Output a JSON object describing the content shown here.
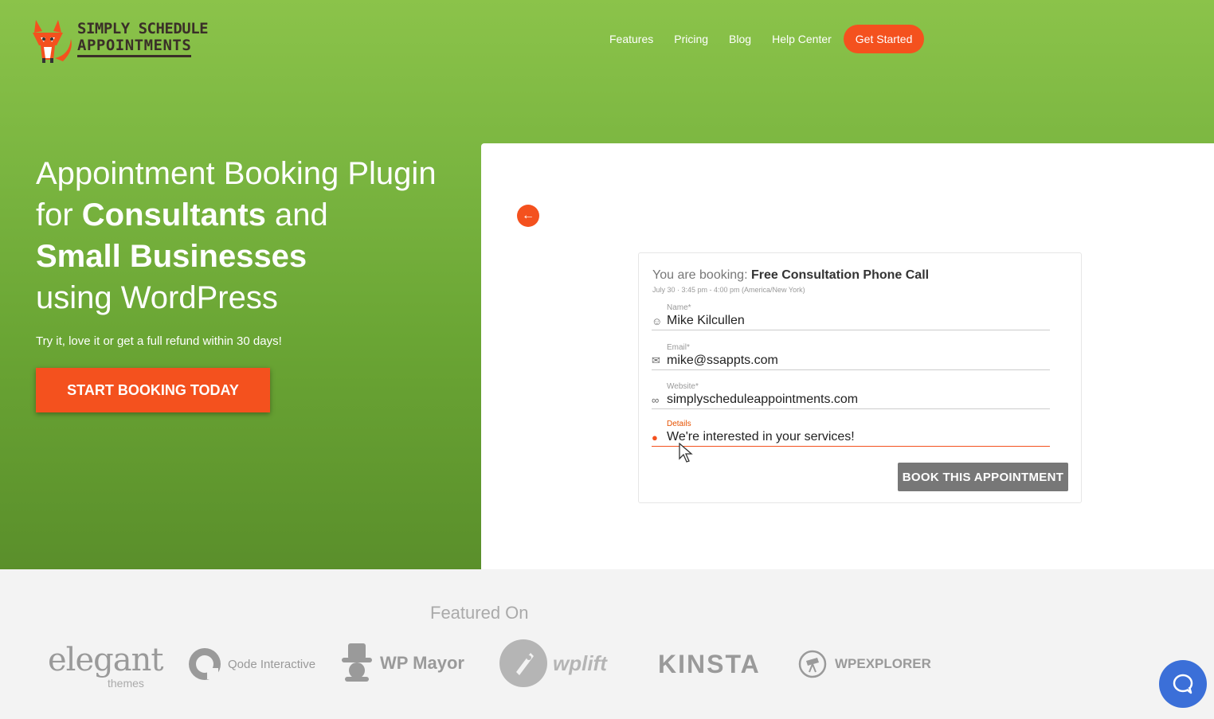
{
  "logo": {
    "line1": "SIMPLY SCHEDULE",
    "line2": "APPOINTMENTS"
  },
  "nav": {
    "items": [
      "Features",
      "Pricing",
      "Blog",
      "Help Center"
    ],
    "cta": "Get Started"
  },
  "hero": {
    "line1": "Appointment Booking Plugin",
    "line2_pre": "for ",
    "line2_bold": "Consultants",
    "line2_post": " and",
    "line3_bold": "Small Businesses",
    "line4": "using WordPress",
    "subtitle": "Try it, love it or get a full refund within 30 days!",
    "button": "START BOOKING TODAY"
  },
  "booking": {
    "title_prefix": "You are booking: ",
    "title_event": "Free Consultation Phone Call",
    "subtitle": "July 30  ·  3:45 pm - 4:00 pm (America/New York)",
    "fields": [
      {
        "label": "Name*",
        "value": "Mike Kilcullen",
        "icon": "user-icon"
      },
      {
        "label": "Email*",
        "value": "mike@ssappts.com",
        "icon": "mail-icon"
      },
      {
        "label": "Website*",
        "value": "simplyscheduleappointments.com",
        "icon": "link-icon"
      },
      {
        "label": "Details",
        "value": "We're interested in your services!",
        "icon": "info-icon"
      }
    ],
    "button": "BOOK THIS APPOINTMENT"
  },
  "featured": {
    "title": "Featured On",
    "brands": [
      "elegant",
      "themes",
      "Qode Interactive",
      "WP Mayor",
      "wplift",
      "kinsta",
      "WPEXPLORER"
    ]
  },
  "colors": {
    "accent": "#f4511e",
    "green": "#7ab540",
    "button_gray": "#777777",
    "chat": "#3b6fd8"
  }
}
